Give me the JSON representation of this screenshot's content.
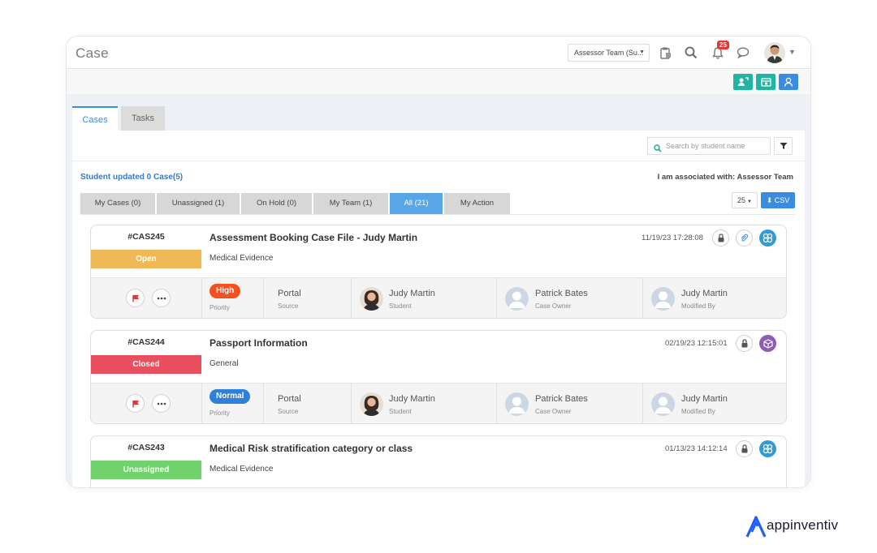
{
  "header": {
    "title": "Case",
    "team_select": "Assessor Team (Su...",
    "notification_count": "25"
  },
  "tabs": [
    {
      "label": "Cases",
      "active": true
    },
    {
      "label": "Tasks",
      "active": false
    }
  ],
  "search": {
    "placeholder": "Search by student name"
  },
  "summary": {
    "updated": "Student updated 0 Case(5)",
    "associated": "I am associated with: Assessor Team"
  },
  "subtabs": [
    {
      "label": "My Cases (0)",
      "active": false
    },
    {
      "label": "Unassigned (1)",
      "active": false
    },
    {
      "label": "On Hold (0)",
      "active": false
    },
    {
      "label": "My Team (1)",
      "active": false
    },
    {
      "label": "All (21)",
      "active": true
    },
    {
      "label": "My Action",
      "active": false
    }
  ],
  "page_size": "25",
  "csv_label": "CSV",
  "labels": {
    "priority": "Priority",
    "source": "Source",
    "student": "Student",
    "case_owner": "Case Owner",
    "modified_by": "Modified By"
  },
  "cases": [
    {
      "id": "#CAS245",
      "status": "Open",
      "status_color": "#f0b956",
      "title": "Assessment Booking Case File - Judy Martin",
      "category": "Medical Evidence",
      "datetime": "11/19/23 17:28:08",
      "priority": "High",
      "priority_color": "#f4511e",
      "source": "Portal",
      "student": "Judy Martin",
      "case_owner": "Patrick Bates",
      "modified_by": "Judy Martin",
      "type_icon": "blue-network-icon"
    },
    {
      "id": "#CAS244",
      "status": "Closed",
      "status_color": "#e9505f",
      "title": "Passport Information",
      "category": "General",
      "datetime": "02/19/23 12:15:01",
      "priority": "Normal",
      "priority_color": "#2f80d8",
      "source": "Portal",
      "student": "Judy Martin",
      "case_owner": "Patrick Bates",
      "modified_by": "Judy Martin",
      "type_icon": "purple-box-icon"
    },
    {
      "id": "#CAS243",
      "status": "Unassigned",
      "status_color": "#6fd26a",
      "title": "Medical Risk stratification category or class",
      "category": "Medical Evidence",
      "datetime": "01/13/23 14:12:14",
      "type_icon": "blue-network-icon"
    }
  ],
  "brand": {
    "name": "appinventiv"
  },
  "colors": {
    "accent": "#3a8dde",
    "teal_button": "#1fb5a0",
    "blue_button": "#3a8dde"
  }
}
